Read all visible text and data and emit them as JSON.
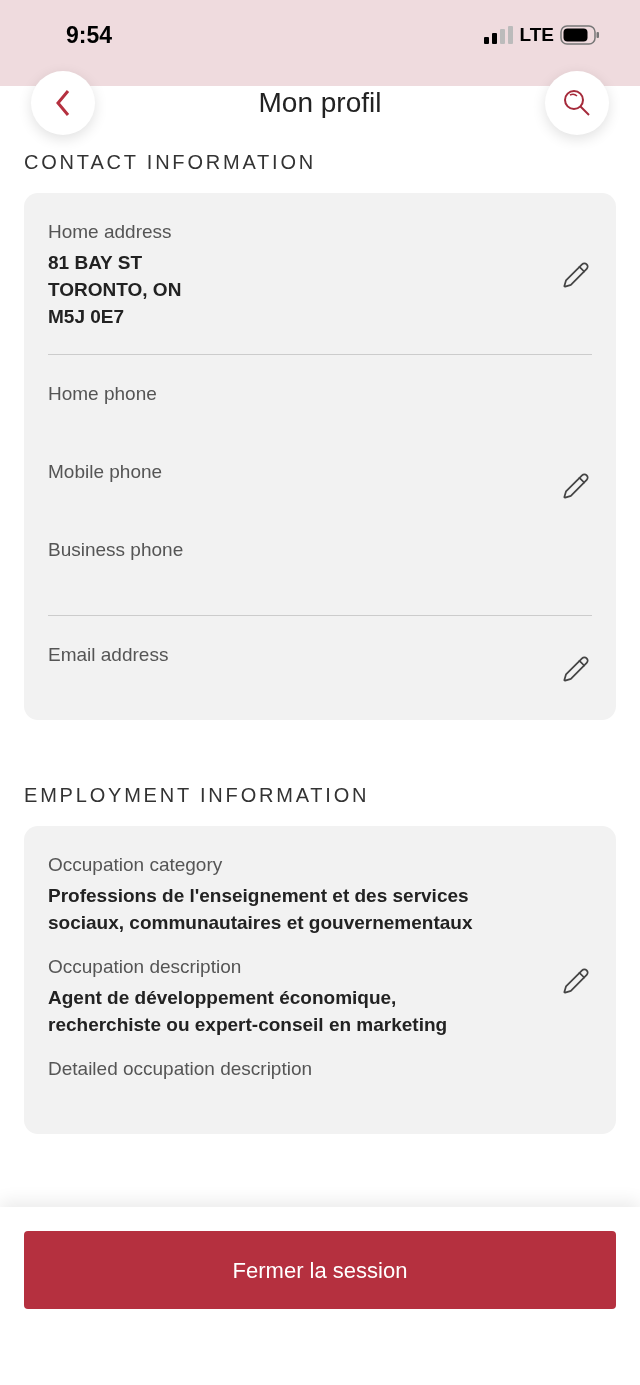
{
  "status_bar": {
    "time": "9:54",
    "network": "LTE"
  },
  "header": {
    "title": "Mon profil"
  },
  "sections": [
    {
      "title": "CONTACT INFORMATION",
      "groups": [
        {
          "fields": [
            {
              "label": "Home address",
              "value_lines": [
                "81 BAY ST",
                "TORONTO, ON",
                "M5J 0E7"
              ]
            }
          ]
        },
        {
          "fields": [
            {
              "label": "Home phone"
            },
            {
              "label": "Mobile phone"
            },
            {
              "label": "Business phone"
            }
          ]
        },
        {
          "fields": [
            {
              "label": "Email address"
            }
          ]
        }
      ]
    },
    {
      "title": "EMPLOYMENT INFORMATION",
      "groups": [
        {
          "fields": [
            {
              "label": "Occupation category",
              "value_lines": [
                "Professions de l'enseignement et des services",
                "sociaux, communautaires et gouvernementaux"
              ]
            },
            {
              "label": "Occupation description",
              "value_lines": [
                "Agent de développement économique,",
                "recherchiste ou expert-conseil en marketing"
              ]
            },
            {
              "label": "Detailed occupation description"
            }
          ]
        }
      ]
    }
  ],
  "footer": {
    "button": "Fermer la session"
  }
}
